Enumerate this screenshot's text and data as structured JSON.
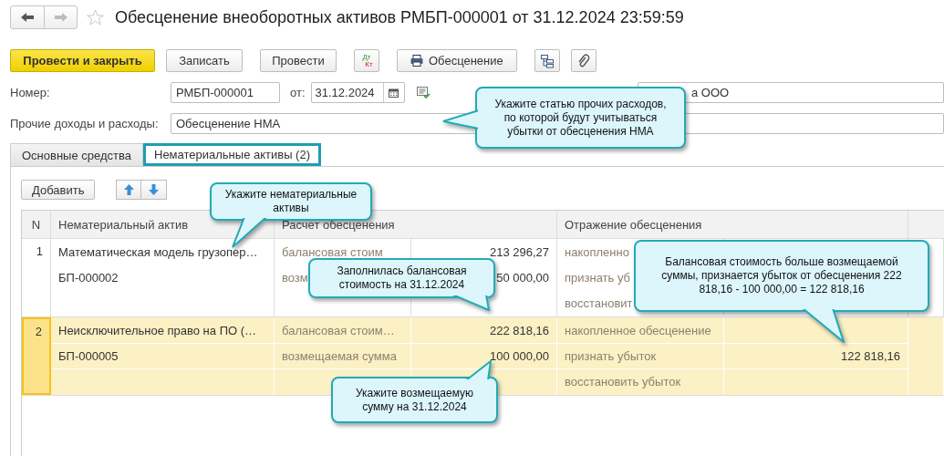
{
  "window": {
    "title": "Обесценение внеоборотных активов РМБП-000001 от 31.12.2024 23:59:59"
  },
  "toolbar": [
    {
      "kind": "primary",
      "label": "Провести и закрыть"
    },
    {
      "kind": "text",
      "label": "Записать"
    },
    {
      "kind": "text",
      "label": "Провести"
    },
    {
      "kind": "dtkt",
      "top": "Дт",
      "bottom": "Кт"
    },
    {
      "kind": "print",
      "label": "Обесценение"
    },
    {
      "kind": "structure"
    },
    {
      "kind": "attach"
    }
  ],
  "form": {
    "number_label": "Номер:",
    "number": "РМБП-000001",
    "date_label": "от:",
    "date": "31.12.2024",
    "organization": "а ООО",
    "expense_label": "Прочие доходы и расходы:",
    "expense": "Обесценение НМА"
  },
  "tabs": [
    {
      "label": "Основные средства",
      "selected": false
    },
    {
      "label": "Нематериальные активы (2)",
      "selected": true
    }
  ],
  "add_button": "Добавить",
  "table": {
    "columns": [
      "N",
      "Нематериальный актив",
      "Расчет обесценения",
      "Отражение обесценения"
    ],
    "rows": [
      {
        "n": "1",
        "selected": false,
        "asset": "Математическая модель грузопер…",
        "code": "БП-000002",
        "calc": [
          {
            "label": "балансовая стоим",
            "value": "213 296,27"
          },
          {
            "label": "возм",
            "value": "50 000,00"
          }
        ],
        "reflection": [
          {
            "label": "накопленно"
          },
          {
            "label": "признать уб"
          },
          {
            "label": "восстановит"
          }
        ]
      },
      {
        "n": "2",
        "selected": true,
        "asset": "Неисключительное право на ПО (…",
        "code": "БП-000005",
        "calc": [
          {
            "label": "балансовая стоим…",
            "value": "222 818,16"
          },
          {
            "label": "возмещаемая сумма",
            "value": "100 000,00"
          }
        ],
        "reflection": [
          {
            "label": "накопленное обесценение"
          },
          {
            "label": "признать убыток",
            "value": "122 818,16"
          },
          {
            "label": "восстановить убыток"
          }
        ]
      }
    ]
  },
  "callouts": [
    {
      "text": "Укажите статью прочих расходов, по которой будут учитываться убытки от обесценения НМА"
    },
    {
      "text": "Укажите нематериальные активы"
    },
    {
      "text": "Заполнилась балансовая стоимость на 31.12.2024"
    },
    {
      "text": "Балансовая стоимость больше возмещаемой суммы, признается убыток от обесценения 222 818,16 - 100 000,00 = 122 818,16"
    },
    {
      "text": "Укажите возмещаемую сумму на 31.12.2024"
    }
  ]
}
